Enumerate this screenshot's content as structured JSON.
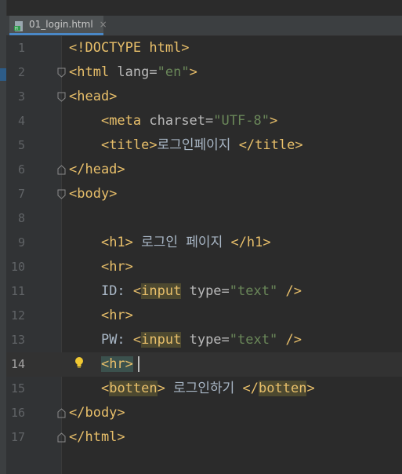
{
  "tab": {
    "label": "01_login.html",
    "close": "×"
  },
  "lines": [
    {
      "n": "1",
      "segs": [
        {
          "t": "<!DOCTYPE html>",
          "c": "tag"
        }
      ]
    },
    {
      "n": "2",
      "fold": "open",
      "segs": [
        {
          "t": "<html ",
          "c": "tag"
        },
        {
          "t": "lang",
          "c": "attr"
        },
        {
          "t": "=",
          "c": "attr"
        },
        {
          "t": "\"en\"",
          "c": "val"
        },
        {
          "t": ">",
          "c": "tag"
        }
      ]
    },
    {
      "n": "3",
      "fold": "open",
      "segs": [
        {
          "t": "<head>",
          "c": "tag"
        }
      ]
    },
    {
      "n": "4",
      "segs": [
        {
          "t": "    "
        },
        {
          "t": "<meta ",
          "c": "tag"
        },
        {
          "t": "charset",
          "c": "attr"
        },
        {
          "t": "=",
          "c": "attr"
        },
        {
          "t": "\"UTF-8\"",
          "c": "val"
        },
        {
          "t": ">",
          "c": "tag"
        }
      ]
    },
    {
      "n": "5",
      "segs": [
        {
          "t": "    "
        },
        {
          "t": "<title>",
          "c": "tag"
        },
        {
          "t": "로그인페이지 ",
          "c": "txt"
        },
        {
          "t": "</title>",
          "c": "tag"
        }
      ]
    },
    {
      "n": "6",
      "fold": "close",
      "segs": [
        {
          "t": "</head>",
          "c": "tag"
        }
      ]
    },
    {
      "n": "7",
      "fold": "open",
      "segs": [
        {
          "t": "<body>",
          "c": "tag"
        }
      ]
    },
    {
      "n": "8",
      "segs": []
    },
    {
      "n": "9",
      "segs": [
        {
          "t": "    "
        },
        {
          "t": "<h1>",
          "c": "tag"
        },
        {
          "t": " 로그인 페이지 ",
          "c": "txt"
        },
        {
          "t": "</h1>",
          "c": "tag"
        }
      ]
    },
    {
      "n": "10",
      "segs": [
        {
          "t": "    "
        },
        {
          "t": "<hr>",
          "c": "tag"
        }
      ]
    },
    {
      "n": "11",
      "segs": [
        {
          "t": "    "
        },
        {
          "t": "ID: ",
          "c": "txt"
        },
        {
          "t": "<",
          "c": "tag"
        },
        {
          "t": "input",
          "c": "tag hl"
        },
        {
          "t": " ",
          "c": "tag"
        },
        {
          "t": "type",
          "c": "attr"
        },
        {
          "t": "=",
          "c": "attr"
        },
        {
          "t": "\"text\"",
          "c": "val"
        },
        {
          "t": " />",
          "c": "tag"
        }
      ]
    },
    {
      "n": "12",
      "segs": [
        {
          "t": "    "
        },
        {
          "t": "<hr>",
          "c": "tag"
        }
      ]
    },
    {
      "n": "13",
      "segs": [
        {
          "t": "    "
        },
        {
          "t": "PW: ",
          "c": "txt"
        },
        {
          "t": "<",
          "c": "tag"
        },
        {
          "t": "input",
          "c": "tag hl"
        },
        {
          "t": " ",
          "c": "tag"
        },
        {
          "t": "type",
          "c": "attr"
        },
        {
          "t": "=",
          "c": "attr"
        },
        {
          "t": "\"text\"",
          "c": "val"
        },
        {
          "t": " />",
          "c": "tag"
        }
      ]
    },
    {
      "n": "14",
      "active": true,
      "segs": [
        {
          "t": "    "
        },
        {
          "t": "<hr>",
          "c": "tag match"
        }
      ]
    },
    {
      "n": "15",
      "segs": [
        {
          "t": "    "
        },
        {
          "t": "<",
          "c": "tag"
        },
        {
          "t": "botten",
          "c": "tag hl"
        },
        {
          "t": ">",
          "c": "tag"
        },
        {
          "t": " 로그인하기 ",
          "c": "txt"
        },
        {
          "t": "</",
          "c": "tag"
        },
        {
          "t": "botten",
          "c": "tag hl"
        },
        {
          "t": ">",
          "c": "tag"
        }
      ]
    },
    {
      "n": "16",
      "fold": "close",
      "segs": [
        {
          "t": "</body>",
          "c": "tag"
        }
      ]
    },
    {
      "n": "17",
      "fold": "close",
      "segs": [
        {
          "t": "</html>",
          "c": "tag"
        }
      ]
    }
  ],
  "icons": {
    "file": "html-file-icon",
    "bulb": "lightbulb-icon",
    "fold_open": "fold-open-icon",
    "fold_close": "fold-close-icon"
  }
}
